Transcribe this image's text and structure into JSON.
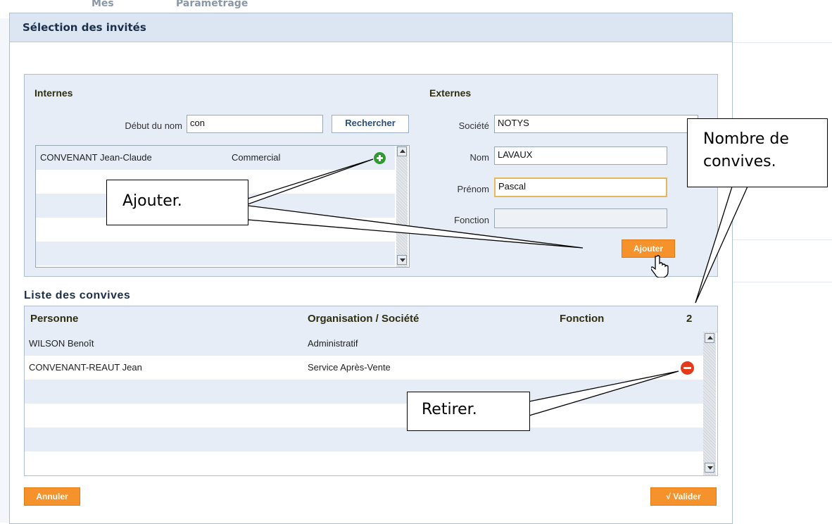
{
  "background_tabs": [
    "Mes",
    "Paramétrage"
  ],
  "dialog": {
    "title": "Sélection des invités"
  },
  "internes": {
    "title": "Internes",
    "search_label": "Début du nom",
    "search_value": "con",
    "search_button": "Rechercher",
    "results": [
      {
        "name": "CONVENANT Jean-Claude",
        "role": "Commercial"
      }
    ]
  },
  "externes": {
    "title": "Externes",
    "fields": [
      {
        "label": "Société",
        "value": "NOTYS"
      },
      {
        "label": "Nom",
        "value": "LAVAUX"
      },
      {
        "label": "Prénom",
        "value": "Pascal"
      },
      {
        "label": "Fonction",
        "value": ""
      }
    ],
    "add_button": "Ajouter"
  },
  "guests": {
    "title": "Liste des convives",
    "columns": [
      "Personne",
      "Organisation / Société",
      "Fonction"
    ],
    "count": "2",
    "rows": [
      {
        "person": "WILSON Benoît",
        "organisation": "Administratif",
        "fonction": ""
      },
      {
        "person": "CONVENANT-REAUT Jean",
        "organisation": "Service Après-Vente",
        "fonction": ""
      }
    ]
  },
  "footer": {
    "cancel": "Annuler",
    "validate": "Valider",
    "validate_icon": "√"
  },
  "callouts": {
    "add": "Ajouter.",
    "remove": "Retirer.",
    "count_line1": "Nombre de",
    "count_line2": "convives."
  },
  "colors": {
    "accent_orange": "#f5922b",
    "panel_blue": "#e6edf6",
    "add_green": "#2f9a2f",
    "remove_red": "#e23a1a"
  }
}
